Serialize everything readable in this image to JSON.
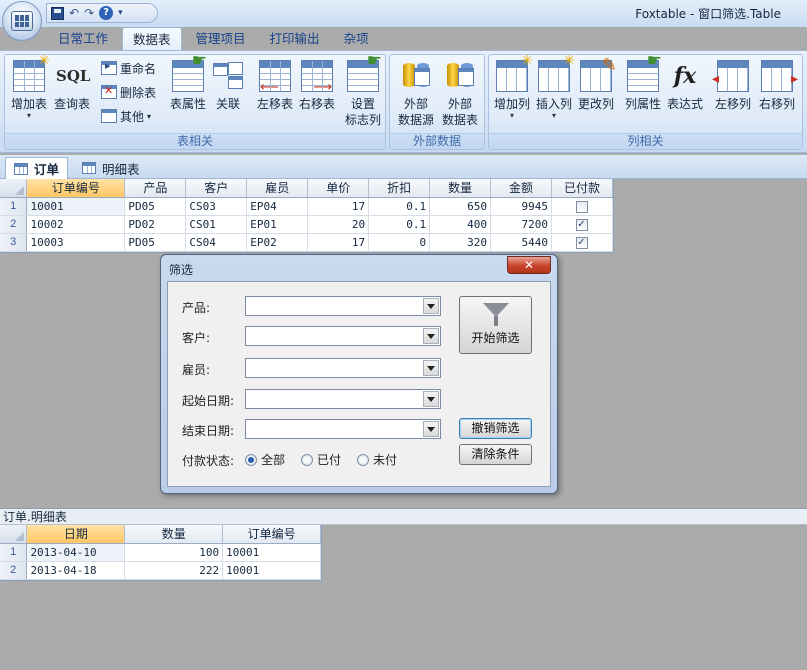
{
  "window": {
    "title": "Foxtable - 窗口筛选.Table"
  },
  "ribbon": {
    "tabs": [
      "日常工作",
      "数据表",
      "管理项目",
      "打印输出",
      "杂项"
    ],
    "active_tab": "数据表",
    "groups": {
      "table": {
        "label": "表相关",
        "buttons": {
          "add_table": "增加表",
          "sql": "SQL",
          "sql_label": "查询表",
          "rename": "重命名",
          "delete_table": "删除表",
          "other": "其他",
          "table_props": "表属性",
          "relations": "关联",
          "move_left": "左移表",
          "move_right": "右移表",
          "flag_col_1": "设置",
          "flag_col_2": "标志列"
        }
      },
      "external": {
        "label": "外部数据",
        "buttons": {
          "ext_source_1": "外部",
          "ext_source_2": "数据源",
          "ext_table_1": "外部",
          "ext_table_2": "数据表"
        }
      },
      "column": {
        "label": "列相关",
        "buttons": {
          "add_col": "增加列",
          "insert_col": "插入列",
          "change_col": "更改列",
          "col_props": "列属性",
          "expression": "表达式",
          "col_left": "左移列",
          "col_right": "右移列"
        }
      }
    }
  },
  "sheet_tabs": [
    "订单",
    "明细表"
  ],
  "orders": {
    "columns": [
      "订单编号",
      "产品",
      "客户",
      "雇员",
      "单价",
      "折扣",
      "数量",
      "金额",
      "已付款"
    ],
    "rows": [
      {
        "n": "1",
        "id": "10001",
        "product": "PD05",
        "customer": "CS03",
        "employee": "EP04",
        "price": "17",
        "discount": "0.1",
        "qty": "650",
        "amount": "9945",
        "paid": false
      },
      {
        "n": "2",
        "id": "10002",
        "product": "PD02",
        "customer": "CS01",
        "employee": "EP01",
        "price": "20",
        "discount": "0.1",
        "qty": "400",
        "amount": "7200",
        "paid": true
      },
      {
        "n": "3",
        "id": "10003",
        "product": "PD05",
        "customer": "CS04",
        "employee": "EP02",
        "price": "17",
        "discount": "0",
        "qty": "320",
        "amount": "5440",
        "paid": true
      }
    ]
  },
  "detail": {
    "caption": "订单.明细表",
    "columns": [
      "日期",
      "数量",
      "订单编号"
    ],
    "rows": [
      {
        "n": "1",
        "date": "2013-04-10",
        "qty": "100",
        "order_id": "10001"
      },
      {
        "n": "2",
        "date": "2013-04-18",
        "qty": "222",
        "order_id": "10001"
      }
    ]
  },
  "filter_dialog": {
    "title": "筛选",
    "fields": {
      "product": {
        "label": "产品:",
        "value": ""
      },
      "customer": {
        "label": "客户:",
        "value": ""
      },
      "employee": {
        "label": "雇员:",
        "value": ""
      },
      "start_date": {
        "label": "起始日期:",
        "value": ""
      },
      "end_date": {
        "label": "结束日期:",
        "value": ""
      }
    },
    "pay_status": {
      "label": "付款状态:",
      "options": [
        "全部",
        "已付",
        "未付"
      ],
      "selected": "全部"
    },
    "buttons": {
      "start": "开始筛选",
      "cancel": "撤销筛选",
      "clear": "清除条件"
    }
  }
}
